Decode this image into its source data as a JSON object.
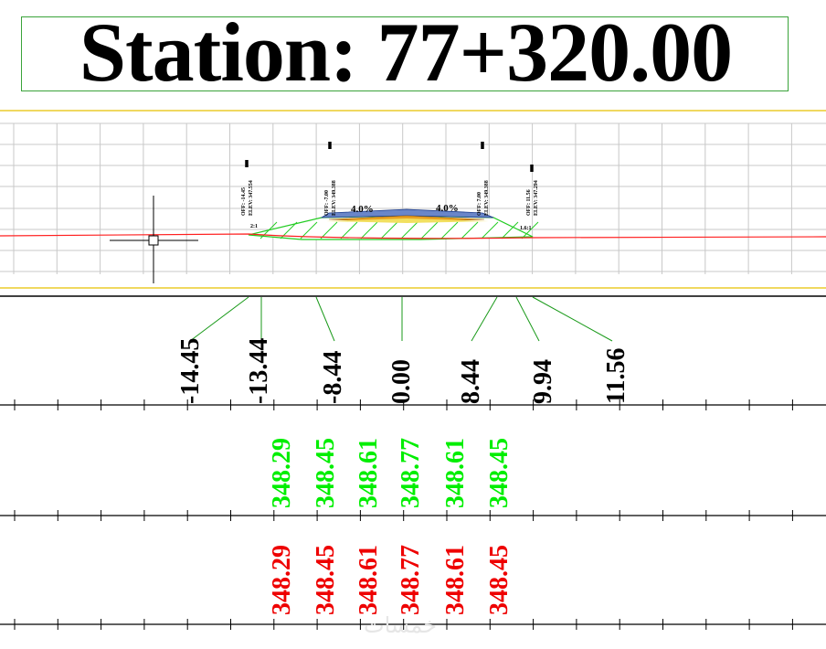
{
  "station": {
    "title": "Station: 77+320.00"
  },
  "section": {
    "slope_left": "4.0%",
    "slope_right": "4.0%",
    "side_slope_left": "2:1",
    "side_slope_right": "1.6:1",
    "callouts": [
      {
        "off": "OFF: -14.45",
        "elev": "ELEV: 347.554"
      },
      {
        "off": "OFF: -7.00",
        "elev": "ELEV: 349.388"
      },
      {
        "off": "OFF: 7.00",
        "elev": "ELEV: 349.388"
      },
      {
        "off": "OFF: 11.56",
        "elev": "ELEV: 347.294"
      }
    ]
  },
  "offsets": [
    "-14.45",
    "-13.44",
    "-8.44",
    "0.00",
    "8.44",
    "9.94",
    "11.56"
  ],
  "design_elevations": [
    "348.29",
    "348.45",
    "348.61",
    "348.77",
    "348.61",
    "348.45"
  ],
  "existing_elevations": [
    "348.29",
    "348.45",
    "348.61",
    "348.77",
    "348.61",
    "348.45"
  ],
  "colors": {
    "design_elevation": "#00ee00",
    "existing_elevation": "#ee0000",
    "ground_line": "#ff2020",
    "hatch": "#22cc22",
    "frame_line": "#e8c000",
    "grid": "#c8c8c8",
    "leader": "#1a9a1a"
  },
  "watermark": "خمسات"
}
